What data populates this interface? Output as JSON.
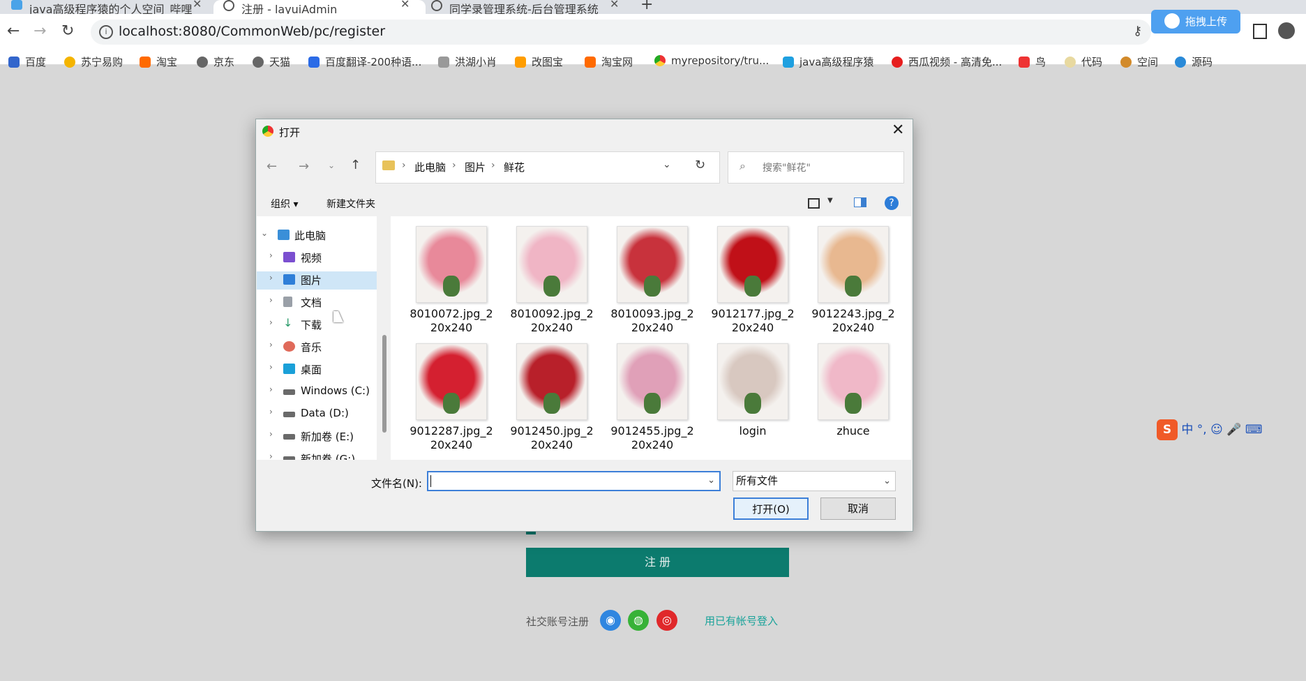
{
  "browser": {
    "tabs": [
      {
        "label": "java高级程序猿的个人空间_哔哩",
        "active": false
      },
      {
        "label": "注册 - layuiAdmin",
        "active": true
      },
      {
        "label": "同学录管理系统-后台管理系统",
        "active": false
      }
    ],
    "new_tab": "+",
    "url": "localhost:8080/CommonWeb/pc/register",
    "bookmarks": [
      "百度",
      "苏宁易购",
      "淘宝",
      "京东",
      "天猫",
      "百度翻译-200种语...",
      "洪湖小肖",
      "改图宝",
      "淘宝网",
      "myrepository/tru...",
      "java高级程序猿",
      "西瓜视频 - 高清免...",
      "鸟",
      "代码",
      "空间",
      "源码"
    ]
  },
  "page": {
    "register_button": "注 册",
    "social_label": "社交账号注册",
    "login_link": "用已有帐号登入"
  },
  "dialog": {
    "title": "打开",
    "breadcrumb": [
      "此电脑",
      "图片",
      "鲜花"
    ],
    "search_placeholder": "搜索\"鲜花\"",
    "toolbar": {
      "organize": "组织 ▾",
      "new_folder": "新建文件夹"
    },
    "tree": [
      {
        "label": "此电脑",
        "expanded": true
      },
      {
        "label": "视频"
      },
      {
        "label": "图片",
        "selected": true
      },
      {
        "label": "文档"
      },
      {
        "label": "下载"
      },
      {
        "label": "音乐"
      },
      {
        "label": "桌面"
      },
      {
        "label": "Windows (C:)"
      },
      {
        "label": "Data (D:)"
      },
      {
        "label": "新加卷 (E:)"
      },
      {
        "label": "新加卷 (G:)"
      }
    ],
    "files": [
      {
        "name": "8010072.jpg_220x240",
        "color": "#e8899a"
      },
      {
        "name": "8010092.jpg_220x240",
        "color": "#f0b5c5"
      },
      {
        "name": "8010093.jpg_220x240",
        "color": "#c8323c"
      },
      {
        "name": "9012177.jpg_220x240",
        "color": "#c01018"
      },
      {
        "name": "9012243.jpg_220x240",
        "color": "#e8b890"
      },
      {
        "name": "9012287.jpg_220x240",
        "color": "#d42030"
      },
      {
        "name": "9012450.jpg_220x240",
        "color": "#b8202a"
      },
      {
        "name": "9012455.jpg_220x240",
        "color": "#e0a0b8"
      },
      {
        "name": "login",
        "color": "#d8c8c0"
      },
      {
        "name": "zhuce",
        "color": "#f0b8c8"
      }
    ],
    "filename_label": "文件名(N):",
    "filename_value": "",
    "filetype_value": "所有文件",
    "open_button": "打开(O)",
    "cancel_button": "取消"
  },
  "widgets": {
    "upload_label": "拖拽上传",
    "ime_label": "中 °, ☺ 🎤 ⌨"
  }
}
